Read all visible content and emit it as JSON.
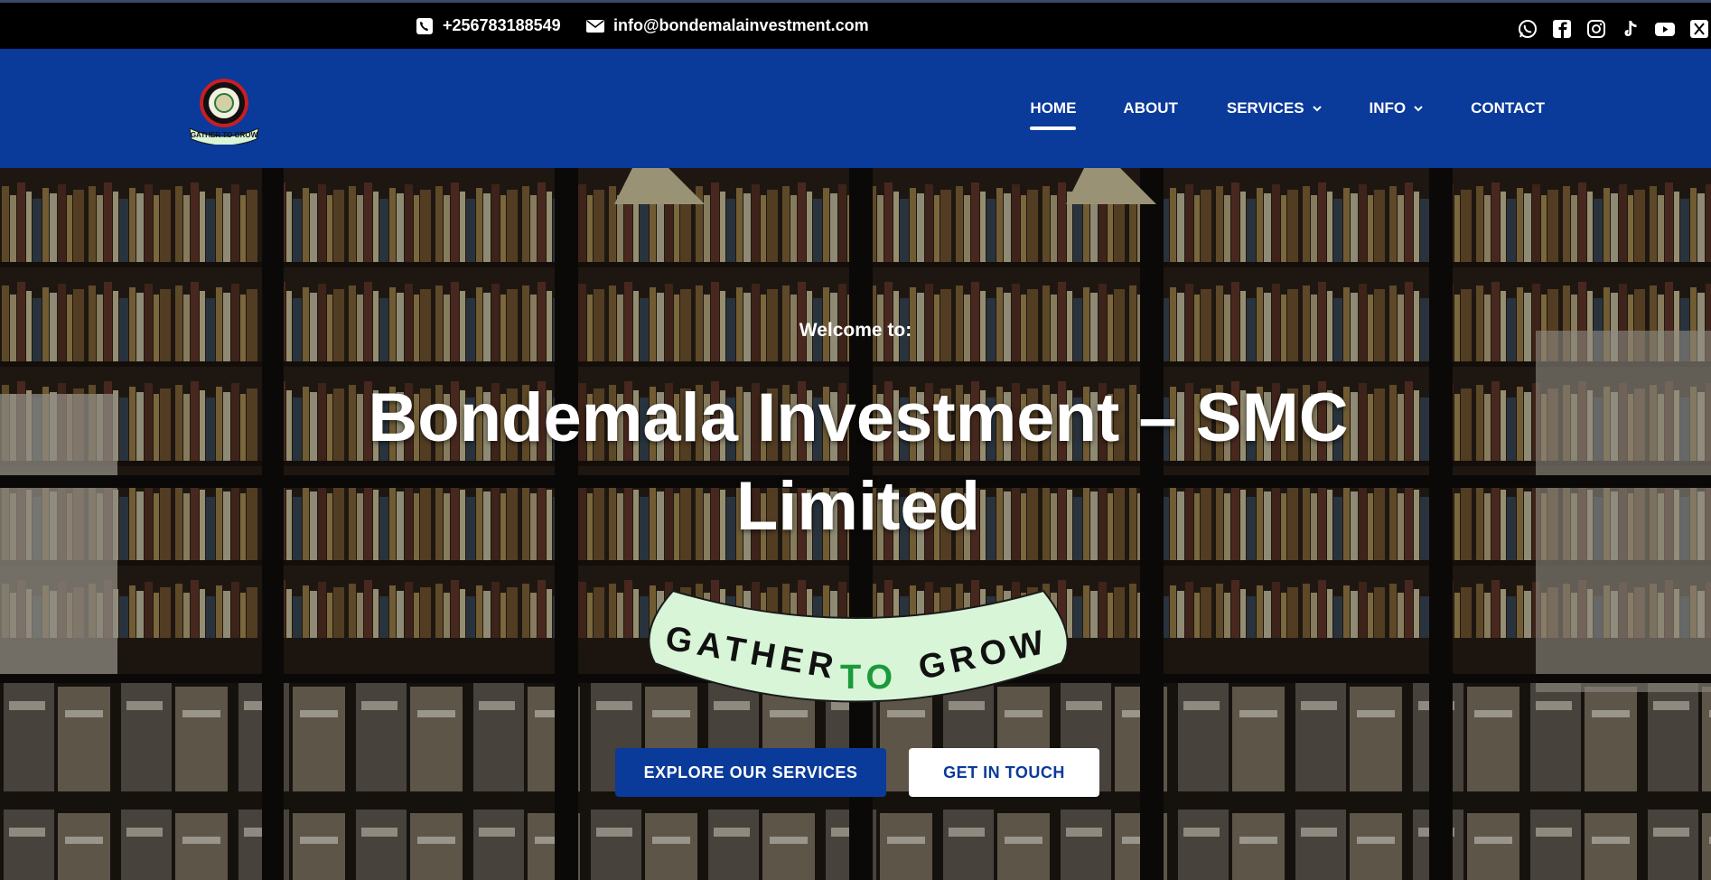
{
  "topbar": {
    "phone": "+256783188549",
    "email": "info@bondemalainvestment.com",
    "socials": [
      "whatsapp-icon",
      "facebook-icon",
      "instagram-icon",
      "tiktok-icon",
      "youtube-icon",
      "x-icon"
    ]
  },
  "header": {
    "logo_text": "GATHER TO GROW",
    "nav": [
      {
        "label": "HOME",
        "active": true
      },
      {
        "label": "ABOUT"
      },
      {
        "label": "SERVICES",
        "dropdown": true
      },
      {
        "label": "INFO",
        "dropdown": true
      },
      {
        "label": "CONTACT"
      }
    ]
  },
  "hero": {
    "welcome": "Welcome to:",
    "title": "Bondemala Investment – SMC Limited",
    "tagline": "GATHER TO GROW",
    "primary_button": "EXPLORE OUR SERVICES",
    "secondary_button": "GET IN TOUCH"
  },
  "colors": {
    "brand_blue": "#0a3a9a",
    "topbar": "#000000",
    "tagline_green": "#1a9a3a",
    "tagline_bg": "#d8f5d8"
  }
}
